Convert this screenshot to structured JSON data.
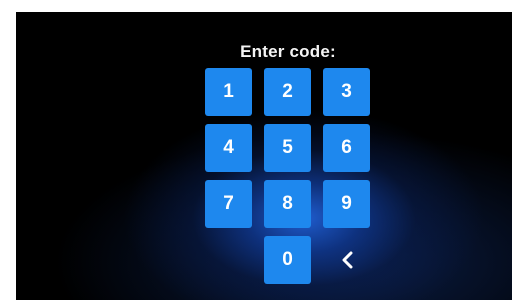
{
  "prompt": {
    "title": "Enter code:"
  },
  "keypad": {
    "keys": [
      {
        "label": "1"
      },
      {
        "label": "2"
      },
      {
        "label": "3"
      },
      {
        "label": "4"
      },
      {
        "label": "5"
      },
      {
        "label": "6"
      },
      {
        "label": "7"
      },
      {
        "label": "8"
      },
      {
        "label": "9"
      },
      {
        "label": "0"
      }
    ],
    "backspace_icon": "chevron-left-icon"
  },
  "colors": {
    "key_background": "#1e88ee",
    "key_text": "#ffffff",
    "screen_background": "#000000",
    "glow": "#2060d6"
  }
}
